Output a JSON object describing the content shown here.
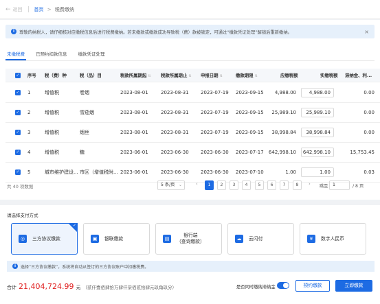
{
  "topbar": {
    "back_label": "返回",
    "crumb_home": "首页",
    "crumb_gt": ">",
    "crumb_current": "税费缴纳"
  },
  "notice": {
    "text": "尊敬的纳税人，请仔细核对应缴税信息后进行税费缴纳。若未缴款或缴款成功导致税（费）款被锁定，可通过“缴款凭证处理”解锁后重新缴纳。",
    "close": "×"
  },
  "tabs": [
    "未缴税费",
    "已预约扣款信息",
    "缴款凭证处理"
  ],
  "table": {
    "headers": [
      "序号",
      "税（费）种",
      "税（品）目",
      "税款所属期起",
      "税款所属期止",
      "申报日期",
      "缴款期限",
      "应缴税额",
      "实缴税额",
      "滞纳金、利..."
    ],
    "rows": [
      {
        "no": "1",
        "tax": "增值税",
        "item": "卷烟",
        "start": "2023-08-01",
        "end": "2023-08-31",
        "declare": "2023-07-19",
        "deadline": "2023-09-15",
        "due": "4,988.00",
        "paid": "4,988.00",
        "late": "0.00"
      },
      {
        "no": "2",
        "tax": "增值税",
        "item": "雪茄烟",
        "start": "2023-08-01",
        "end": "2023-08-31",
        "declare": "2023-07-19",
        "deadline": "2023-09-15",
        "due": "25,989.10",
        "paid": "25,989.10",
        "late": "0.00"
      },
      {
        "no": "3",
        "tax": "增值税",
        "item": "烟丝",
        "start": "2023-08-01",
        "end": "2023-08-31",
        "declare": "2023-07-19",
        "deadline": "2023-09-15",
        "due": "38,998.84",
        "paid": "38,998.84",
        "late": "0.00"
      },
      {
        "no": "4",
        "tax": "增值税",
        "item": "糖",
        "start": "2023-06-01",
        "end": "2023-06-30",
        "declare": "2023-06-30",
        "deadline": "2023-07-17",
        "due": "642,998.10",
        "paid": "642,998.10",
        "late": "15,753.45"
      },
      {
        "no": "5",
        "tax": "城市维护建设...",
        "item": "市区（增值税附...",
        "start": "2023-06-01",
        "end": "2023-06-30",
        "declare": "2023-06-30",
        "deadline": "2023-07-10",
        "due": "1.00",
        "paid": "1.00",
        "late": "0.03"
      }
    ]
  },
  "pager": {
    "total": "共 40 项数据",
    "page_size": "5 条/页",
    "pages": [
      "1",
      "2",
      "3",
      "4",
      "5",
      "6",
      "7",
      "8"
    ],
    "goto_prefix": "跳至",
    "goto_value": "1",
    "goto_suffix": "/ 8 页"
  },
  "payment": {
    "title": "请选择支付方式",
    "methods": [
      "三方协议缴款",
      "银联缴款",
      "银行端\n（查询缴款）",
      "云闪付",
      "数字人民币"
    ],
    "tip": "选择“三方协议缴款”，系统将自动从签订的三方协议账户中扣缴税费。",
    "total_prefix": "合计",
    "total_amount": "21,404,724.99",
    "total_unit": "元",
    "total_cn": "（贰仟壹佰肆拾万肆仟柒佰贰拾肆元玖角玖分）",
    "switch_label": "是否同时缴纳滞纳金",
    "reserve_button": "预约缴款",
    "pay_button": "立即缴款"
  },
  "colors": {
    "accent": "#1d6be3",
    "amount": "#e02020"
  }
}
